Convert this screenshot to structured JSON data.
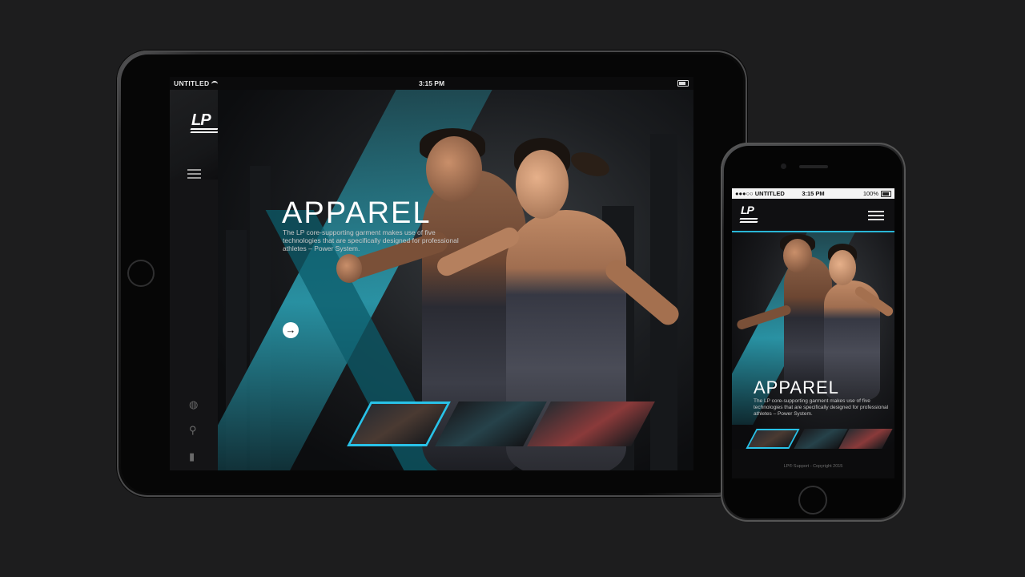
{
  "tablet": {
    "status": {
      "carrier": "UNTITLED",
      "time": "3:15 PM"
    },
    "logo": "LP",
    "hero": {
      "title": "APPAREL",
      "description": "The LP core-supporting garment makes use of five technologies that are specifically designed for professional athletes – Power System.",
      "cta_icon": "→"
    },
    "sidebar_icons": [
      "globe-icon",
      "search-icon",
      "document-icon"
    ],
    "thumbnail_count": 3
  },
  "phone": {
    "status": {
      "carrier": "●●●○○ UNTITLED",
      "time": "3:15 PM",
      "battery": "100%"
    },
    "logo": "LP",
    "hero": {
      "title": "APPAREL",
      "description": "The LP core-supporting garment makes use of five technologies that are specifically designed for professional athletes – Power System."
    },
    "footer": "LP® Support - Copyright 2015"
  },
  "colors": {
    "accent": "#29c2e8",
    "background": "#1d1d1e",
    "teal": "#2ba5b9"
  }
}
